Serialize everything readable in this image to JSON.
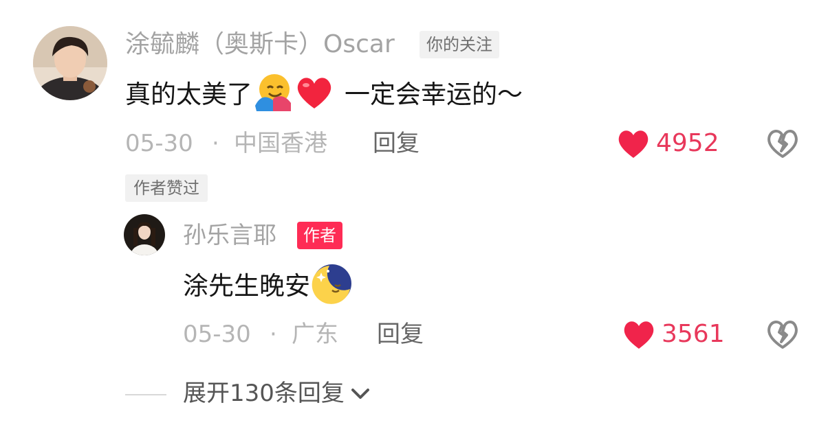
{
  "comment": {
    "username": "涂毓麟（奥斯卡）Oscar",
    "follow_tag": "你的关注",
    "text_before": "真的太美了",
    "text_after": "一定会幸运的～",
    "date": "05-30",
    "separator": "·",
    "location": "中国香港",
    "reply_label": "回复",
    "likes": "4952",
    "author_liked_tag": "作者赞过"
  },
  "reply": {
    "username": "孙乐言耶",
    "author_tag": "作者",
    "text": "涂先生晚安",
    "date": "05-30",
    "separator": "·",
    "location": "广东",
    "reply_label": "回复",
    "likes": "3561"
  },
  "expand": {
    "label": "展开130条回复"
  },
  "icons": {
    "like": "heart-filled-icon",
    "dislike": "broken-heart-icon",
    "expand": "chevron-down-icon",
    "emoji_hug": "hugging-face-emoji",
    "emoji_heart": "red-heart-emoji",
    "emoji_moon": "sleeping-moon-emoji"
  },
  "colors": {
    "accent": "#fe2c55",
    "like_count": "#e8385b"
  }
}
